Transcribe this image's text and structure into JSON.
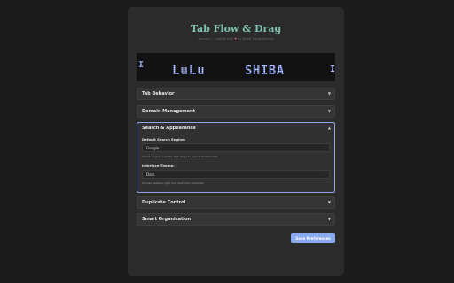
{
  "app": {
    "title": "Tab Flow & Drag",
    "subtitle_prefix": "Version 1 · Crafted with",
    "subtitle_suffix": "by Strobl Tobias Samuel"
  },
  "banner": {
    "left_char": "I",
    "word1": "LuLu",
    "word2": "SHIBA",
    "right_char": "I"
  },
  "sections": {
    "tab_behavior": "Tab Behavior",
    "domain_management": "Domain Management",
    "search_appearance": "Search & Appearance",
    "duplicate_control": "Duplicate Control",
    "smart_organization": "Smart Organization"
  },
  "search_appearance": {
    "engine_label": "Default Search Engine:",
    "engine_value": "Google",
    "engine_hint": "Search engine used for text drags to search functionality.",
    "theme_label": "Interface Theme:",
    "theme_value": "Dark",
    "theme_hint": "Choose between light and dark color schemes."
  },
  "arrows": {
    "collapsed": "▼",
    "expanded": "▲",
    "select": "⌄"
  },
  "save_button": "Save Preferences",
  "colors": {
    "accent_title": "#7fbfb0",
    "accent_button": "#8aaaf0",
    "heart": "#e05a6d",
    "banner_text": "#8fa0ea"
  }
}
